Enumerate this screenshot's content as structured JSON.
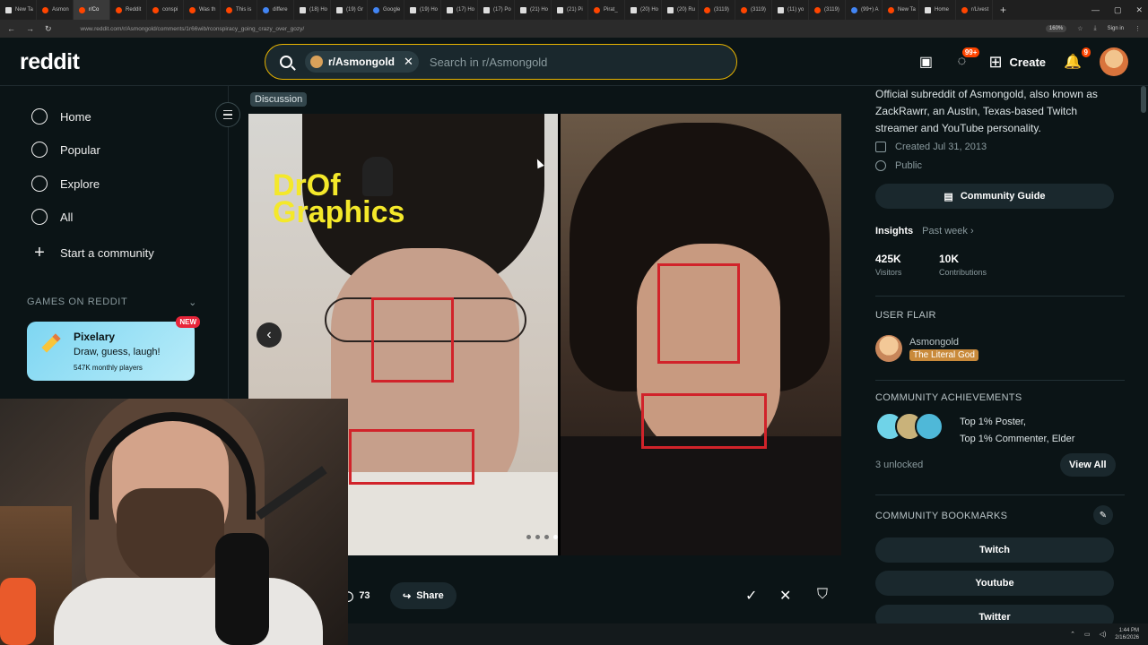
{
  "browser": {
    "tabs": [
      {
        "label": "New Ta",
        "fav": "x",
        "active": false
      },
      {
        "label": "Asmon",
        "fav": "reddit",
        "active": false
      },
      {
        "label": "r/Co",
        "fav": "reddit",
        "active": true
      },
      {
        "label": "Reddit",
        "fav": "reddit",
        "active": false
      },
      {
        "label": "conspi",
        "fav": "reddit",
        "active": false
      },
      {
        "label": "Was th",
        "fav": "reddit",
        "active": false
      },
      {
        "label": "This is",
        "fav": "reddit",
        "active": false
      },
      {
        "label": "differe",
        "fav": "g",
        "active": false
      },
      {
        "label": "(18) Ho",
        "fav": "x",
        "active": false
      },
      {
        "label": "(19) Gr",
        "fav": "x",
        "active": false
      },
      {
        "label": "Google",
        "fav": "g",
        "active": false
      },
      {
        "label": "(19) Ho",
        "fav": "x",
        "active": false
      },
      {
        "label": "(17) Ho",
        "fav": "x",
        "active": false
      },
      {
        "label": "(17) Po",
        "fav": "x",
        "active": false
      },
      {
        "label": "(21) Ho",
        "fav": "x",
        "active": false
      },
      {
        "label": "(21) Pi",
        "fav": "x",
        "active": false
      },
      {
        "label": "Pirat_",
        "fav": "reddit",
        "active": false
      },
      {
        "label": "(20) Ho",
        "fav": "x",
        "active": false
      },
      {
        "label": "(20) Ru",
        "fav": "x",
        "active": false
      },
      {
        "label": "(3119)",
        "fav": "reddit",
        "active": false
      },
      {
        "label": "(3119)",
        "fav": "reddit",
        "active": false
      },
      {
        "label": "(11) yo",
        "fav": "x",
        "active": false
      },
      {
        "label": "(3119)",
        "fav": "reddit",
        "active": false
      },
      {
        "label": "(99+) A",
        "fav": "g",
        "active": false
      },
      {
        "label": "New Ta",
        "fav": "reddit",
        "active": false
      },
      {
        "label": "Home",
        "fav": "x",
        "active": false
      },
      {
        "label": "r/Livest",
        "fav": "reddit",
        "active": false
      }
    ],
    "url": "www.reddit.com/r/Asmongold/comments/1r66wib/rconspiracy_going_crazy_over_gozy/",
    "zoom": "160%",
    "signin": "Sign in"
  },
  "header": {
    "logo": "reddit",
    "search_chip": "r/Asmongold",
    "search_placeholder": "Search in r/Asmongold",
    "chat_badge": "99+",
    "create_label": "Create",
    "notif_badge": "9"
  },
  "nav": {
    "items": [
      {
        "label": "Home",
        "icon": "home-icon"
      },
      {
        "label": "Popular",
        "icon": "popular-icon"
      },
      {
        "label": "Explore",
        "icon": "explore-icon"
      },
      {
        "label": "All",
        "icon": "all-icon"
      },
      {
        "label": "Start a community",
        "icon": "plus-icon"
      }
    ],
    "games_section": "GAMES ON REDDIT",
    "game": {
      "name": "Pixelary",
      "desc": "Draw, guess, laugh!",
      "players": "547K monthly players",
      "badge": "NEW"
    }
  },
  "post": {
    "flair": "Discussion",
    "watermark_line1": "DrOf",
    "watermark_line2": "Graphics",
    "comments": "73",
    "share": "Share",
    "carousel_total": 4,
    "carousel_active": 3
  },
  "sidebar": {
    "about": "Official subreddit of Asmongold, also known as ZackRawrr, an Austin, Texas-based Twitch streamer and YouTube personality.",
    "created": "Created Jul 31, 2013",
    "visibility": "Public",
    "guide": "Community Guide",
    "insights": "Insights",
    "insights_range": "Past week",
    "visitors_value": "425K",
    "visitors_label": "Visitors",
    "contrib_value": "10K",
    "contrib_label": "Contributions",
    "user_flair_title": "USER FLAIR",
    "flair_user": "Asmongold",
    "flair_tag": "The Literal God",
    "ach_title": "COMMUNITY ACHIEVEMENTS",
    "ach_line1": "Top 1% Poster,",
    "ach_line2": "Top 1% Commenter, Elder",
    "unlocked": "3 unlocked",
    "view_all": "View All",
    "bookmarks_title": "COMMUNITY BOOKMARKS",
    "bookmarks": [
      "Twitch",
      "Youtube",
      "Twitter"
    ]
  },
  "taskbar": {
    "time": "1:44 PM",
    "date": "2/16/2026"
  },
  "colors": {
    "accent": "#ff4500",
    "search_border": "#e8b400",
    "flair_tag_bg": "#c98a3b",
    "box_red": "#d1232a"
  }
}
